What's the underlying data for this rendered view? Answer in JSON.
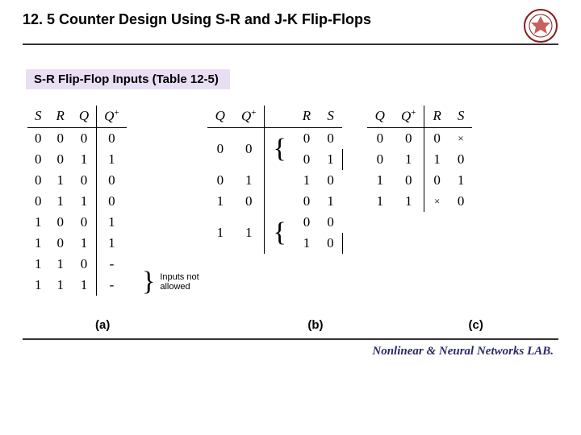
{
  "header": {
    "title": "12. 5 Counter Design Using S-R and J-K Flip-Flops",
    "logo_alt": "university-seal"
  },
  "subtitle": "S-R Flip-Flop Inputs (Table 12-5)",
  "tableA": {
    "headers": [
      "S",
      "R",
      "Q",
      "Q⁺"
    ],
    "rows": [
      [
        "0",
        "0",
        "0",
        "0"
      ],
      [
        "0",
        "0",
        "1",
        "1"
      ],
      [
        "0",
        "1",
        "0",
        "0"
      ],
      [
        "0",
        "1",
        "1",
        "0"
      ],
      [
        "1",
        "0",
        "0",
        "1"
      ],
      [
        "1",
        "0",
        "1",
        "1"
      ],
      [
        "1",
        "1",
        "0",
        "-"
      ],
      [
        "1",
        "1",
        "1",
        "-"
      ]
    ],
    "note": "Inputs not\nallowed"
  },
  "tableB": {
    "headers": [
      "Q",
      "Q⁺",
      "R",
      "S"
    ],
    "groups": [
      {
        "q": "0",
        "qp": "0",
        "rows": [
          [
            "0",
            "0"
          ],
          [
            "0",
            "1"
          ]
        ]
      },
      {
        "q": "0",
        "qp": "1",
        "rows": [
          [
            "1",
            "0"
          ]
        ]
      },
      {
        "q": "1",
        "qp": "0",
        "rows": [
          [
            "0",
            "1"
          ]
        ]
      },
      {
        "q": "1",
        "qp": "1",
        "rows": [
          [
            "0",
            "0"
          ],
          [
            "1",
            "0"
          ]
        ]
      }
    ]
  },
  "tableC": {
    "headers": [
      "Q",
      "Q⁺",
      "R",
      "S"
    ],
    "rows": [
      [
        "0",
        "0",
        "0",
        "×"
      ],
      [
        "0",
        "1",
        "1",
        "0"
      ],
      [
        "1",
        "0",
        "0",
        "1"
      ],
      [
        "1",
        "1",
        "×",
        "0"
      ]
    ]
  },
  "labels": {
    "a": "(a)",
    "b": "(b)",
    "c": "(c)"
  },
  "footer": "Nonlinear & Neural Networks LAB."
}
